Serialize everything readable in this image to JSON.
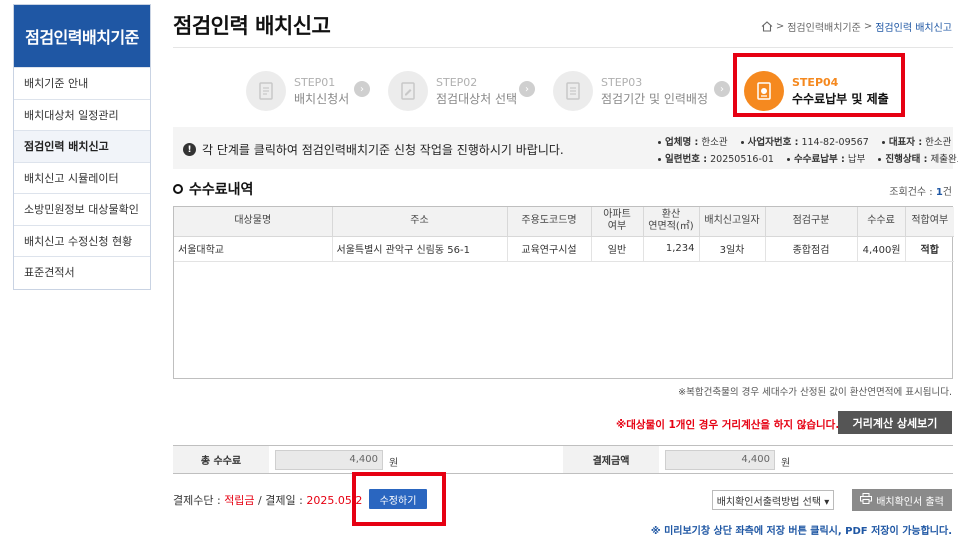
{
  "sidebar": {
    "title": "점검인력배치기준",
    "items": [
      {
        "label": "배치기준 안내"
      },
      {
        "label": "배치대상처 일정관리"
      },
      {
        "label": "점검인력 배치신고"
      },
      {
        "label": "배치신고 시뮬레이터"
      },
      {
        "label": "소방민원정보 대상물확인"
      },
      {
        "label": "배치신고 수정신청 현황"
      },
      {
        "label": "표준견적서"
      }
    ],
    "active_index": 2
  },
  "header": {
    "title": "점검인력 배치신고",
    "breadcrumb": [
      "점검인력배치기준",
      "점검인력 배치신고"
    ],
    "breadcrumb_sep": ">"
  },
  "steps": [
    {
      "no": "STEP01",
      "name": "배치신청서",
      "active": false
    },
    {
      "no": "STEP02",
      "name": "점검대상처 선택",
      "active": false
    },
    {
      "no": "STEP03",
      "name": "점검기간 및 인력배정",
      "active": false
    },
    {
      "no": "STEP04",
      "name": "수수료납부 및 제출",
      "active": true
    }
  ],
  "info": {
    "message": "각 단계를 클릭하여 점검인력배치기준 신청 작업을 진행하시기 바랍니다.",
    "company_label": "업체명 :",
    "company": "한소관",
    "bizno_label": "사업자번호 :",
    "bizno": "114-82-09567",
    "ceo_label": "대표자 :",
    "ceo": "한소관",
    "serial_label": "일련번호 :",
    "serial": "20250516-01",
    "feepaid_label": "수수료납부 :",
    "feepaid": "납부",
    "status_label": "진행상태 :",
    "status": "제출완료"
  },
  "section": {
    "title": "수수료내역",
    "count_label": "조회건수 : ",
    "count_value": "1",
    "count_unit": "건"
  },
  "table": {
    "headers": [
      "대상물명",
      "주소",
      "주용도코드명",
      "아파트\n여부",
      "환산\n연면적(㎡)",
      "배치신고일자",
      "점검구분",
      "수수료",
      "적합여부"
    ],
    "rows": [
      [
        "서울대학교",
        "서울특별시 관악구 신림동 56-1",
        "교육연구시설",
        "일반",
        "1,234",
        "3일차",
        "종합점검",
        "4,400원",
        "적합"
      ]
    ]
  },
  "notes": {
    "composite": "※복합건축물의 경우 세대수가 산정된 값이 환산연면적에 표시됩니다.",
    "distance_warning": "※대상물이 1개인 경우 거리계산을 하지 않습니다.",
    "pdf_tip": "※ 미리보기창 상단 좌측에 저장 버튼 클릭시, PDF 저장이 가능합니다."
  },
  "buttons": {
    "distance_detail": "거리계산 상세보기",
    "edit": "수정하기",
    "print": "배치확인서 출력",
    "print_method": "배치확인서출력방법 선택 ▾"
  },
  "fees": {
    "total_label": "총 수수료",
    "total_value": "4,400",
    "pay_label": "결제금액",
    "pay_value": "4,400",
    "unit": "원"
  },
  "payment": {
    "method_label": "결제수단 : ",
    "method": "적립금",
    "sep": " / ",
    "date_label": "결제일 : ",
    "date": "2025.05.2"
  },
  "colors": {
    "primary": "#1f57a4",
    "accent": "#f5891f",
    "highlight": "#e60012"
  }
}
